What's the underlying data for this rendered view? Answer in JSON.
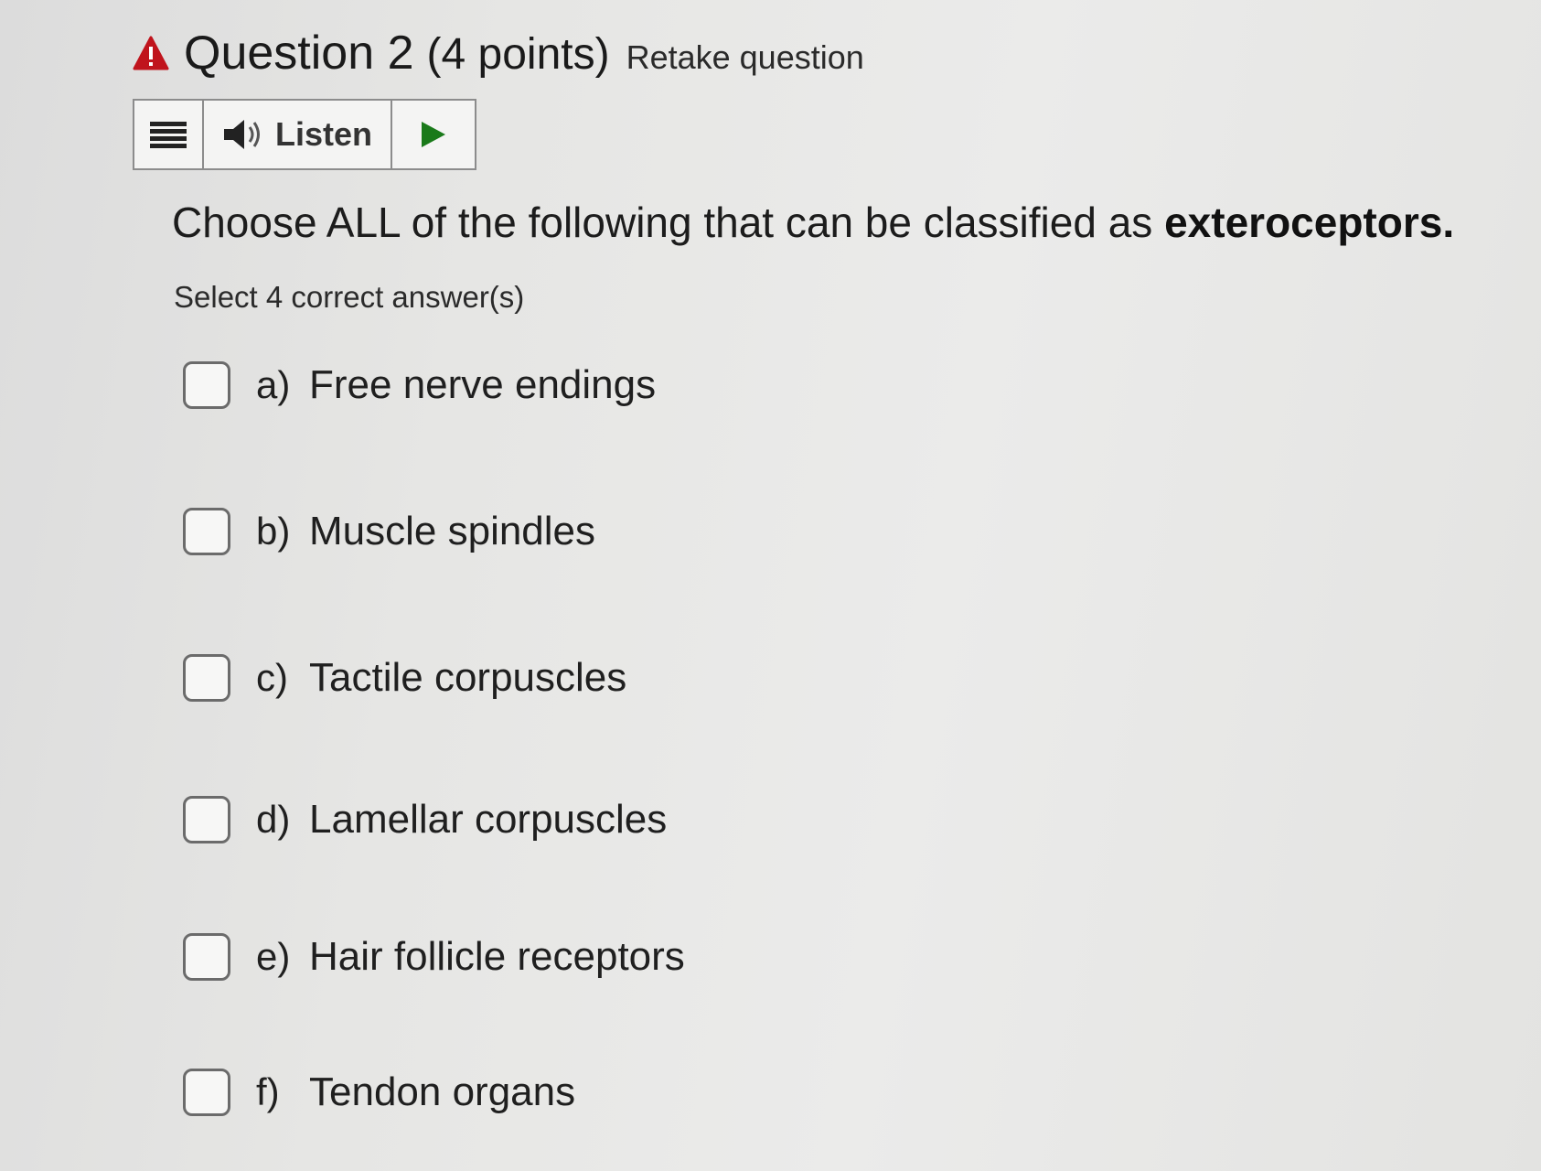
{
  "header": {
    "warning_icon": "warning-triangle-icon",
    "warning_color": "#c0141c",
    "title": "Question 2",
    "points": "(4 points)",
    "retake": "Retake question"
  },
  "toolbar": {
    "menu_icon": "hamburger-menu-icon",
    "speaker_icon": "speaker-icon",
    "listen_label": "Listen",
    "play_icon": "play-icon",
    "play_color": "#1a7a1a"
  },
  "question": {
    "text_prefix": "Choose ALL of the following that can be classified as ",
    "text_bold": "exteroceptors.",
    "instruction": "Select 4 correct answer(s)"
  },
  "options": [
    {
      "letter": "a)",
      "text": "Free nerve endings",
      "checked": false
    },
    {
      "letter": "b)",
      "text": "Muscle spindles",
      "checked": false
    },
    {
      "letter": "c)",
      "text": "Tactile corpuscles",
      "checked": false
    },
    {
      "letter": "d)",
      "text": "Lamellar corpuscles",
      "checked": false
    },
    {
      "letter": "e)",
      "text": "Hair follicle receptors",
      "checked": false
    },
    {
      "letter": "f)",
      "text": "Tendon organs",
      "checked": false
    }
  ]
}
